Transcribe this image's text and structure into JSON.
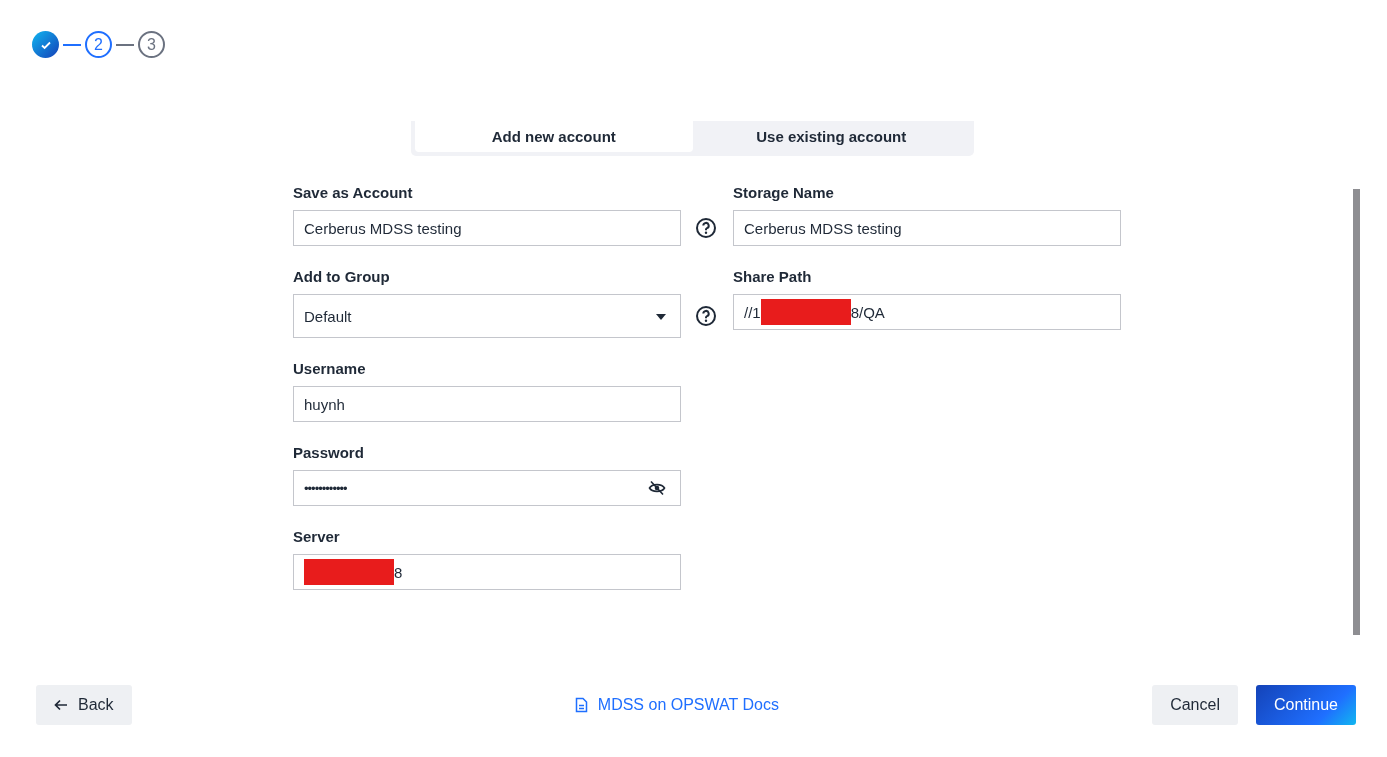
{
  "stepper": [
    {
      "kind": "done"
    },
    {
      "kind": "number",
      "label": "2",
      "selected": true
    },
    {
      "kind": "number",
      "label": "3",
      "selected": false
    }
  ],
  "tabs": [
    {
      "label": "Add new account",
      "selected": true
    },
    {
      "label": "Use existing account",
      "selected": false
    }
  ],
  "left_fields": [
    {
      "kind": "text",
      "label": "Save as Account",
      "value": "Cerberus MDSS testing",
      "help": true
    },
    {
      "kind": "select",
      "label": "Add to Group",
      "value": "Default",
      "help": true
    },
    {
      "kind": "text",
      "label": "Username",
      "value": "huynh",
      "help": false
    },
    {
      "kind": "password",
      "label": "Password",
      "value": "••••••••••••",
      "help": false
    },
    {
      "kind": "redacted",
      "label": "Server",
      "after": "8",
      "help": false
    }
  ],
  "right_fields": [
    {
      "kind": "text",
      "label": "Storage Name",
      "value": "Cerberus MDSS testing"
    },
    {
      "kind": "redacted",
      "label": "Share Path",
      "before": "//1",
      "after": "8/QA"
    }
  ],
  "footer": {
    "back": "Back",
    "docs_link": "MDSS on OPSWAT Docs",
    "cancel": "Cancel",
    "continue": "Continue"
  }
}
